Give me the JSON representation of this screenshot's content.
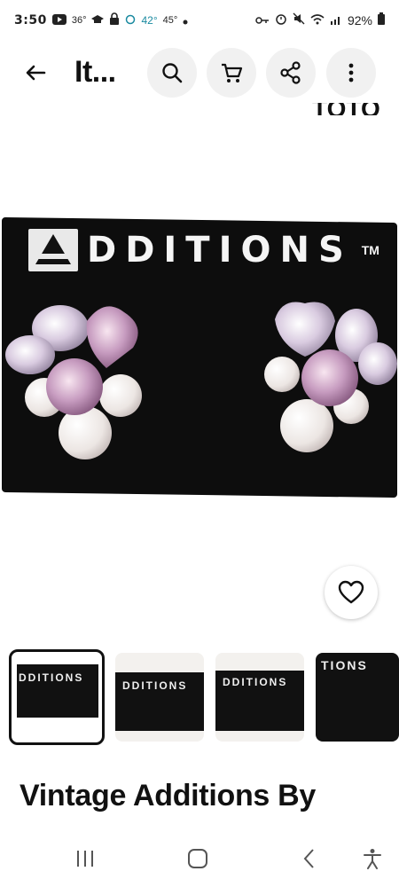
{
  "status_bar": {
    "time": "3:50",
    "temp_small": "36°",
    "temp": "42°",
    "temp_feels": "45°",
    "battery": "92%"
  },
  "app_bar": {
    "title": "It...",
    "icons": [
      "back-arrow-icon",
      "search-icon",
      "cart-icon",
      "share-icon",
      "more-vert-icon"
    ]
  },
  "hero": {
    "peek_text": "TOTO",
    "brand_text": "DDITIONS",
    "trademark": "TM"
  },
  "thumbnails": [
    {
      "label": "DDITIONS",
      "selected": true
    },
    {
      "label": "DDITIONS",
      "selected": false
    },
    {
      "label": "DDITIONS",
      "selected": false
    },
    {
      "label": "TIONS",
      "selected": false
    }
  ],
  "item": {
    "title": "Vintage Additions By"
  },
  "colors": {
    "accent": "#1a8aa0",
    "card": "#0d0d0d",
    "button_bg": "#f1f1f1"
  }
}
